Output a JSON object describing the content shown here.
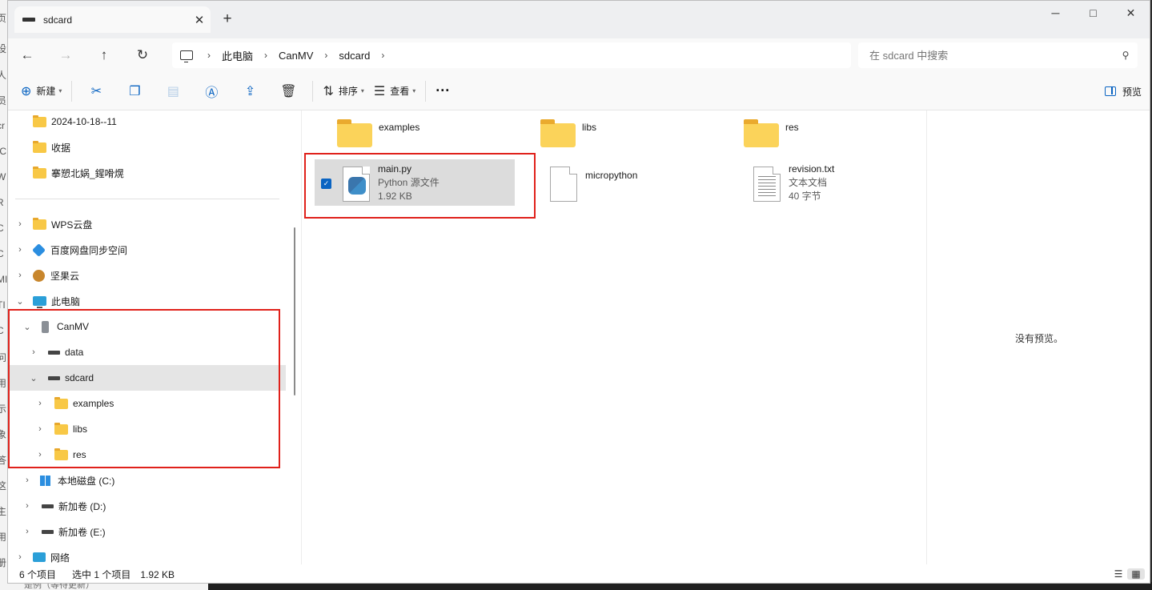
{
  "background": {
    "left_strip_chars": [
      "页",
      "设",
      "人",
      "员",
      "cr",
      "IC",
      "W",
      "R",
      "C",
      "C",
      "MI",
      "TI",
      "C",
      "问",
      "用",
      "示",
      "象",
      "答",
      "这",
      "主",
      "用",
      "册"
    ],
    "bottom_text": "是例（等待更新）"
  },
  "window": {
    "tab_title": "sdcard",
    "controls": {
      "minimize": "─",
      "maximize": "□",
      "close": "✕"
    },
    "new_tab": "+"
  },
  "address": {
    "back": "←",
    "forward": "→",
    "up": "↑",
    "refresh": "↻",
    "crumbs": [
      "此电脑",
      "CanMV",
      "sdcard"
    ],
    "search_placeholder": "在 sdcard 中搜索"
  },
  "toolbar": {
    "new_label": "新建",
    "sort_label": "排序",
    "view_label": "查看",
    "more": "···",
    "preview_label": "预览"
  },
  "sidebar": {
    "pinned": [
      "2024-10-18--11",
      "收据",
      "搴愬北娲_鍟嗗熀"
    ],
    "items": [
      {
        "label": "WPS云盘"
      },
      {
        "label": "百度网盘同步空间"
      },
      {
        "label": "坚果云"
      },
      {
        "label": "此电脑"
      },
      {
        "label": "CanMV"
      },
      {
        "label": "data"
      },
      {
        "label": "sdcard"
      },
      {
        "label": "examples"
      },
      {
        "label": "libs"
      },
      {
        "label": "res"
      },
      {
        "label": "本地磁盘 (C:)"
      },
      {
        "label": "新加卷 (D:)"
      },
      {
        "label": "新加卷 (E:)"
      },
      {
        "label": "网络"
      }
    ]
  },
  "files": {
    "folders": [
      "examples",
      "libs",
      "res"
    ],
    "main_py": {
      "name": "main.py",
      "type": "Python 源文件",
      "size": "1.92 KB"
    },
    "micropython": {
      "name": "micropython"
    },
    "revision": {
      "name": "revision.txt",
      "type": "文本文档",
      "size": "40 字节"
    }
  },
  "preview": {
    "empty_text": "没有预览。"
  },
  "status": {
    "count": "6 个项目",
    "selected": "选中 1 个项目",
    "selected_size": "1.92 KB"
  },
  "colors": {
    "accent": "#0a64c2",
    "highlight_box": "#e0211b",
    "folder": "#fbd35a"
  }
}
